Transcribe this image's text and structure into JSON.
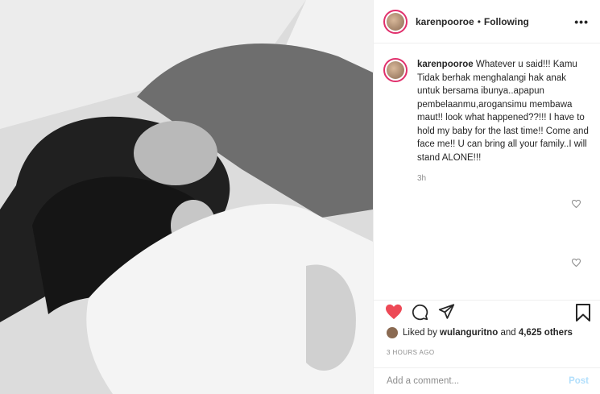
{
  "header": {
    "username": "karenpooroe",
    "separator": "•",
    "follow_status": "Following",
    "more_label": "•••"
  },
  "caption": {
    "username": "karenpooroe",
    "text": "Whatever u said!!! Kamu Tidak berhak menghalangi hak anak untuk bersama ibunya..apapun pembelaanmu,arogansimu membawa maut!! look what happened??!!! I have to hold my baby for the last time!! Come and face me!! U can bring all your family..I will stand ALONE!!!",
    "time": "3h"
  },
  "likes": {
    "prefix": "Liked by",
    "user": "wulanguritno",
    "conjunction": "and",
    "others": "4,625 others"
  },
  "timestamp": "3 HOURS AGO",
  "comment_box": {
    "placeholder": "Add a comment...",
    "post_label": "Post"
  },
  "icons": {
    "like": "heart-filled-icon",
    "comment": "comment-icon",
    "share": "share-icon",
    "save": "bookmark-icon",
    "comment_like": "heart-outline-icon"
  },
  "colors": {
    "like_red": "#ed4956",
    "post_disabled": "#b2dffc",
    "muted": "#8e8e8e"
  }
}
